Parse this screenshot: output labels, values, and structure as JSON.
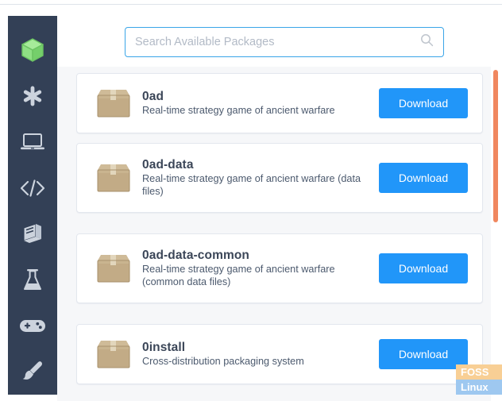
{
  "sidebar": {
    "items": [
      {
        "icon": "cube-icon",
        "label": "Packages",
        "active": true
      },
      {
        "icon": "asterisk-icon",
        "label": "Featured",
        "active": false
      },
      {
        "icon": "laptop-icon",
        "label": "System",
        "active": false
      },
      {
        "icon": "code-icon",
        "label": "Development",
        "active": false
      },
      {
        "icon": "book-icon",
        "label": "Education",
        "active": false
      },
      {
        "icon": "flask-icon",
        "label": "Science",
        "active": false
      },
      {
        "icon": "gamepad-icon",
        "label": "Games",
        "active": false
      },
      {
        "icon": "paintbrush-icon",
        "label": "Graphics",
        "active": false
      }
    ],
    "active_color": "#8fe084",
    "icon_color": "#ccd3dd",
    "background": "#334056"
  },
  "search": {
    "placeholder": "Search Available Packages",
    "value": "",
    "icon": "search-icon",
    "border_color": "#3aa5e8"
  },
  "packages": [
    {
      "name": "0ad",
      "description": "Real-time strategy game of ancient warfare",
      "icon": "package-box-icon",
      "action_label": "Download"
    },
    {
      "name": "0ad-data",
      "description": "Real-time strategy game of ancient warfare (data files)",
      "icon": "package-box-icon",
      "action_label": "Download"
    },
    {
      "name": "0ad-data-common",
      "description": "Real-time strategy game of ancient warfare (common data files)",
      "icon": "package-box-icon",
      "action_label": "Download"
    },
    {
      "name": "0install",
      "description": "Cross-distribution packaging system",
      "icon": "package-box-icon",
      "action_label": "Download"
    }
  ],
  "scrollbar": {
    "color": "#f0875f",
    "orientation": "vertical"
  },
  "watermark": {
    "line1": "FOSS",
    "line2": "Linux",
    "line1_color": "#f8cf95",
    "line2_color": "#9ec8f0"
  },
  "theme": {
    "accent_button": "#2196f9",
    "sidebar_bg": "#334056",
    "list_bg": "#f6f7f9",
    "card_bg": "#ffffff"
  }
}
